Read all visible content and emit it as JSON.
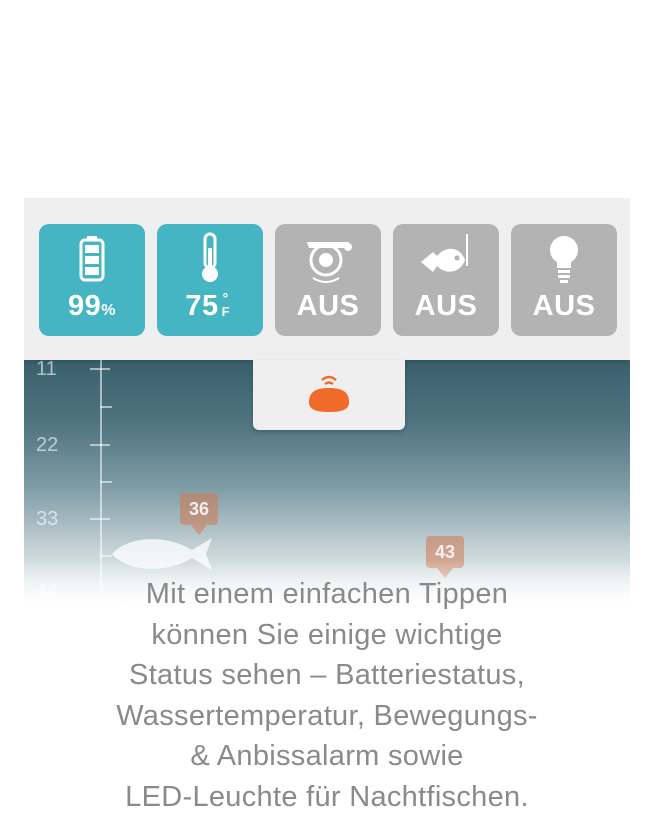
{
  "status_tiles": [
    {
      "id": "battery",
      "icon": "battery-icon",
      "value": "99",
      "unit": "%",
      "active": true
    },
    {
      "id": "water-temp",
      "icon": "thermometer-icon",
      "value": "75",
      "unit_deg": "°",
      "unit": "F",
      "active": true
    },
    {
      "id": "motion-alarm",
      "icon": "alarm-bell-icon",
      "value": "AUS",
      "active": false
    },
    {
      "id": "bite-alarm",
      "icon": "fish-hook-icon",
      "value": "AUS",
      "active": false
    },
    {
      "id": "led-light",
      "icon": "light-bulb-icon",
      "value": "AUS",
      "active": false
    }
  ],
  "sonar": {
    "depth_labels": [
      "11",
      "22",
      "33",
      "44"
    ],
    "fish_depths": [
      "36",
      "43"
    ]
  },
  "colors": {
    "tile_active": "#45b5c3",
    "tile_inactive": "#b3b3b3",
    "sonar_device": "#f06a2a",
    "caption_text": "#8a8a8a"
  },
  "caption": {
    "line1": "Mit einem einfachen Tippen",
    "line2": "können Sie einige wichtige",
    "line3": "Status sehen – Batteriestatus,",
    "line4": "Wassertemperatur, Bewegungs-",
    "line5": "& Anbissalarm sowie",
    "line6": "LED-Leuchte für Nachtfischen."
  }
}
